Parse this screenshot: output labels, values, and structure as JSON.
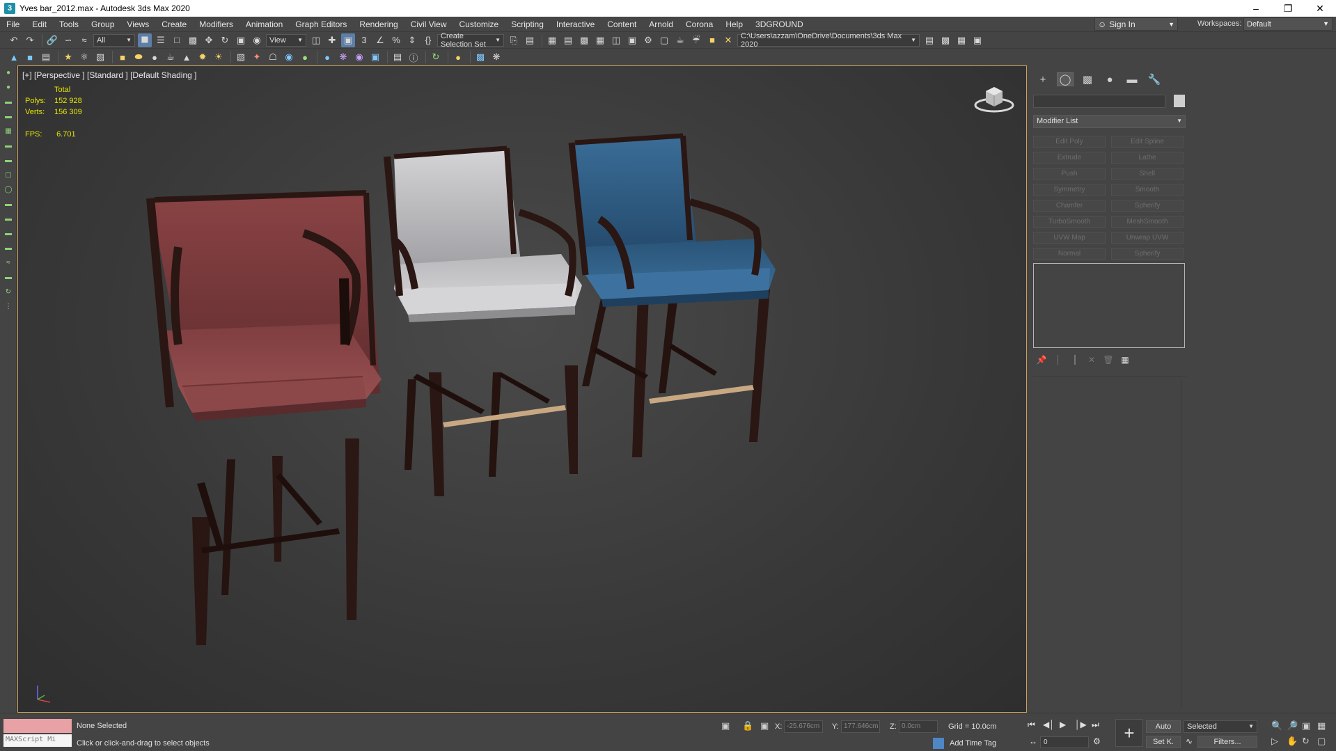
{
  "window": {
    "title": "Yves bar_2012.max - Autodesk 3ds Max 2020",
    "app_icon": "3"
  },
  "menu": [
    "File",
    "Edit",
    "Tools",
    "Group",
    "Views",
    "Create",
    "Modifiers",
    "Animation",
    "Graph Editors",
    "Rendering",
    "Civil View",
    "Customize",
    "Scripting",
    "Interactive",
    "Content",
    "Arnold",
    "Corona",
    "Help",
    "3DGROUND"
  ],
  "header": {
    "sign_in": "Sign In",
    "workspaces_label": "Workspaces:",
    "workspace_value": "Default"
  },
  "toolbar": {
    "selection_filter": "All",
    "ref_coord": "View",
    "named_selection": "Create Selection Set",
    "project_path": "C:\\Users\\azzam\\OneDrive\\Documents\\3ds Max 2020"
  },
  "viewport": {
    "label": "[+] [Perspective ] [Standard ] [Default Shading ]",
    "stats": {
      "total_label": "Total",
      "polys_label": "Polys:",
      "polys_value": "152 928",
      "verts_label": "Verts:",
      "verts_value": "156 309",
      "fps_label": "FPS:",
      "fps_value": "6.701"
    },
    "chair_colors": {
      "red": "#7a3c3e",
      "white": "#c9c9cb",
      "blue": "#2f5d86",
      "wood": "#2a1612"
    }
  },
  "command_panel": {
    "modifier_list": "Modifier List",
    "modifier_buttons": [
      "Edit Poly",
      "Edit Spline",
      "Extrude",
      "Lathe",
      "Push",
      "Shell",
      "Symmetry",
      "Smooth",
      "Chamfer",
      "Spherify",
      "TurboSmooth",
      "MeshSmooth",
      "UVW Map",
      "Unwrap UVW",
      "Normal",
      "Spherify"
    ]
  },
  "status": {
    "maxscript": "MAXScript Mi",
    "selection": "None Selected",
    "prompt": "Click or click-and-drag to select objects",
    "x_label": "X:",
    "x_value": "-25.676cm",
    "y_label": "Y:",
    "y_value": "177.646cm",
    "z_label": "Z:",
    "z_value": "0.0cm",
    "grid": "Grid = 10.0cm",
    "add_time_tag": "Add Time Tag",
    "auto": "Auto",
    "set_key": "Set K.",
    "key_filter": "Selected",
    "filters": "Filters...",
    "frame": "0"
  }
}
